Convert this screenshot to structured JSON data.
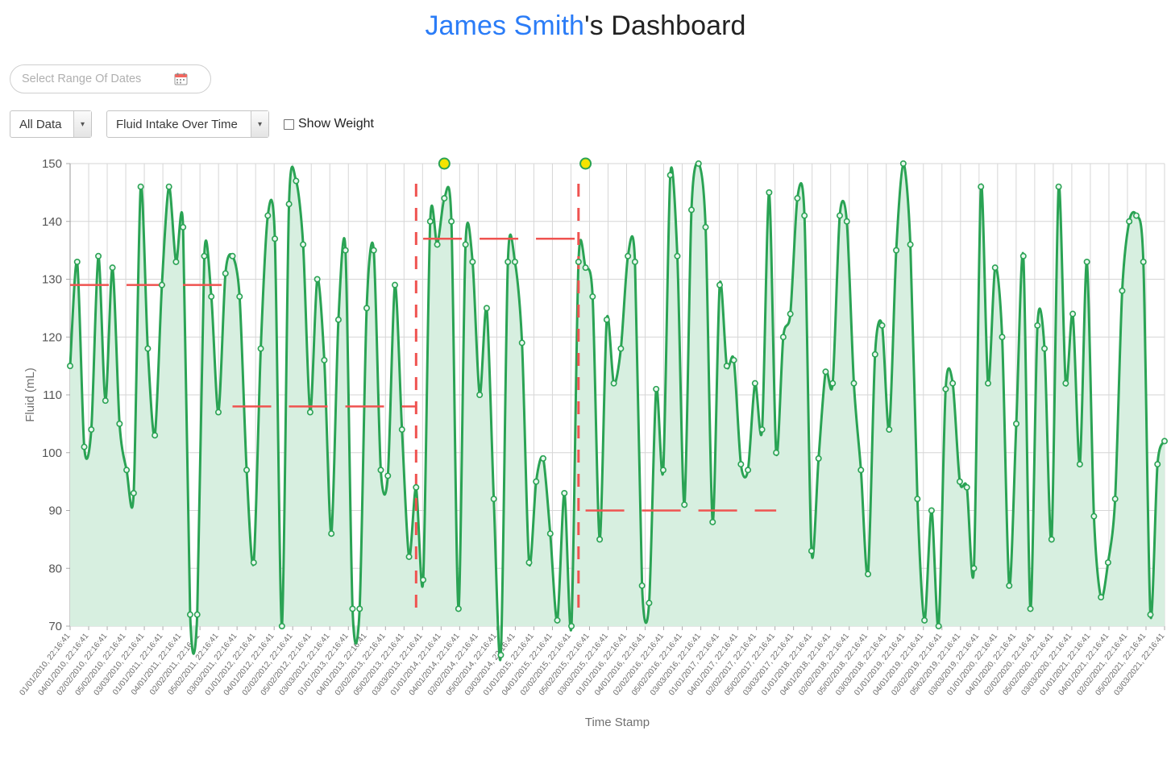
{
  "header": {
    "user_name": "James Smith",
    "title_suffix": "'s Dashboard"
  },
  "controls": {
    "date_range": {
      "value": "",
      "placeholder": "Select Range Of Dates",
      "icon": "calendar-icon"
    },
    "data_filter": {
      "selected": "All Data",
      "arrow_icon": "chevron-down-icon"
    },
    "metric_select": {
      "selected": "Fluid Intake Over Time",
      "arrow_icon": "chevron-down-icon"
    },
    "show_weight": {
      "label": "Show Weight",
      "checked": false
    }
  },
  "colors": {
    "accent_blue": "#2a7cf7",
    "line_green": "#2aa354",
    "fill_green": "#d7efe0",
    "threshold_red": "#ef5350",
    "highlight_yellow": "#f5e400",
    "grid": "#d6d6d6"
  },
  "chart_data": {
    "type": "line",
    "title": "",
    "xlabel": "Time Stamp",
    "ylabel": "Fluid (mL)",
    "ylim": [
      70,
      150
    ],
    "yticks": [
      70,
      80,
      90,
      100,
      110,
      120,
      130,
      140,
      150
    ],
    "grid": true,
    "legend": null,
    "area_fill": true,
    "markers": true,
    "categories": [
      "01/01/2010, 22:16:41",
      "04/01/2010, 22:16:41",
      "02/02/2010, 22:16:41",
      "05/02/2010, 22:16:41",
      "03/03/2010, 22:16:41",
      "01/01/2011, 22:16:41",
      "04/01/2011, 22:16:41",
      "02/02/2011, 22:16:41",
      "05/02/2011, 22:16:41",
      "03/03/2011, 22:16:41",
      "01/01/2012, 22:16:41",
      "04/01/2012, 22:16:41",
      "02/02/2012, 22:16:41",
      "05/02/2012, 22:16:41",
      "03/03/2012, 22:16:41",
      "01/01/2013, 22:16:41",
      "04/01/2013, 22:16:41",
      "02/02/2013, 22:16:41",
      "05/02/2013, 22:16:41",
      "03/03/2013, 22:16:41",
      "01/01/2014, 22:16:41",
      "04/01/2014, 22:16:41",
      "02/02/2014, 22:16:41",
      "05/02/2014, 22:16:41",
      "03/03/2014, 22:16:41",
      "01/01/2015, 22:16:41",
      "04/01/2015, 22:16:41",
      "02/02/2015, 22:16:41",
      "05/02/2015, 22:16:41",
      "03/03/2015, 22:16:41",
      "01/01/2016, 22:16:41",
      "04/01/2016, 22:16:41",
      "02/02/2016, 22:16:41",
      "05/02/2016, 22:16:41",
      "03/03/2016, 22:16:41",
      "01/01/2017, 22:16:41",
      "04/01/2017, 22:16:41",
      "02/02/2017, 22:16:41",
      "05/02/2017, 22:16:41",
      "03/03/2017, 22:16:41",
      "01/01/2018, 22:16:41",
      "04/01/2018, 22:16:41",
      "02/02/2018, 22:16:41",
      "05/02/2018, 22:16:41",
      "03/03/2018, 22:16:41",
      "01/01/2019, 22:16:41",
      "04/01/2019, 22:16:41",
      "02/02/2019, 22:16:41",
      "05/02/2019, 22:16:41",
      "03/03/2019, 22:16:41",
      "01/01/2020, 22:16:41",
      "04/01/2020, 22:16:41",
      "02/02/2020, 22:16:41",
      "05/02/2020, 22:16:41",
      "03/03/2020, 22:16:41",
      "01/01/2021, 22:16:41",
      "04/01/2021, 22:16:41",
      "02/02/2021, 22:16:41",
      "05/02/2021, 22:16:41",
      "03/03/2021, 22:16:41"
    ],
    "values": [
      115,
      133,
      101,
      104,
      134,
      109,
      132,
      105,
      97,
      93,
      146,
      118,
      103,
      129,
      146,
      133,
      139,
      72,
      72,
      134,
      127,
      107,
      131,
      134,
      127,
      97,
      81,
      118,
      141,
      137,
      70,
      143,
      147,
      136,
      107,
      130,
      116,
      86,
      123,
      135,
      73,
      73,
      125,
      135,
      97,
      96,
      129,
      104,
      82,
      94,
      78,
      140,
      136,
      144,
      140,
      73,
      136,
      133,
      110,
      125,
      92,
      65,
      133,
      133,
      119,
      81,
      95,
      99,
      86,
      71,
      93,
      70,
      133,
      132,
      127,
      85,
      123,
      112,
      118,
      134,
      133,
      77,
      74,
      111,
      97,
      148,
      134,
      91,
      142,
      150,
      139,
      88,
      129,
      115,
      116,
      98,
      97,
      112,
      104,
      145,
      100,
      120,
      124,
      144,
      141,
      83,
      99,
      114,
      112,
      141,
      140,
      112,
      97,
      79,
      117,
      122,
      104,
      135,
      150,
      136,
      92,
      71,
      90,
      70,
      111,
      112,
      95,
      94,
      80,
      146,
      112,
      132,
      120,
      77,
      105,
      134,
      73,
      122,
      118,
      85,
      146,
      112,
      124,
      98,
      133,
      89,
      75,
      81,
      92,
      128,
      140,
      141,
      133,
      72,
      98,
      102
    ],
    "threshold_segments": [
      {
        "y": 129,
        "x_start": 0,
        "x_end": 22
      },
      {
        "y": 108,
        "x_start": 23,
        "x_end": 49
      },
      {
        "y": 137,
        "x_start": 50,
        "x_end": 72
      },
      {
        "y": 90,
        "x_start": 73,
        "x_end": 100
      }
    ],
    "vertical_markers": [
      {
        "x_index": 49,
        "style": "dashed",
        "color": "#ef5350"
      },
      {
        "x_index": 72,
        "style": "dashed",
        "color": "#ef5350"
      }
    ],
    "highlighted_points": [
      {
        "x_index": 53,
        "value": 150,
        "color": "#f5e400"
      },
      {
        "x_index": 73,
        "value": 150,
        "color": "#f5e400"
      }
    ]
  }
}
